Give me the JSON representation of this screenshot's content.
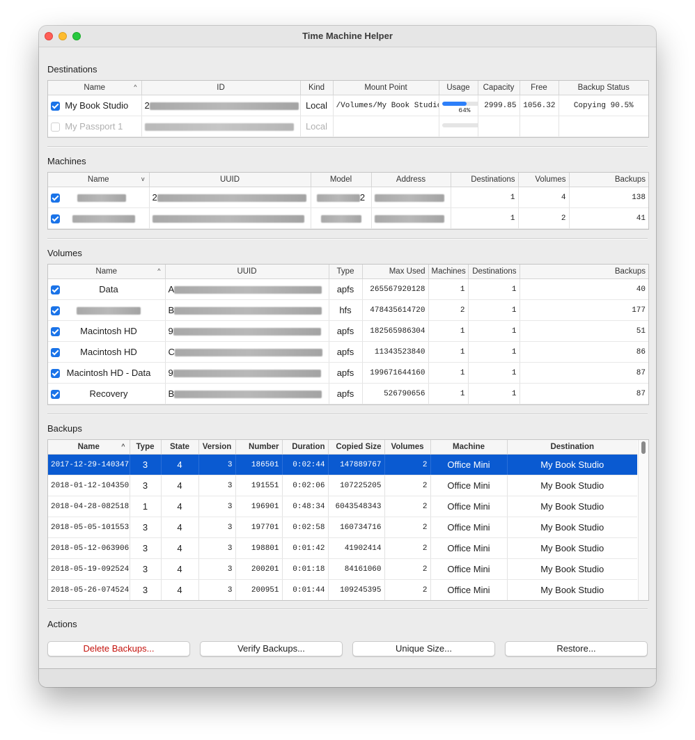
{
  "window": {
    "title": "Time Machine Helper"
  },
  "destinations": {
    "section_title": "Destinations",
    "columns": [
      "Name",
      "ID",
      "Kind",
      "Mount Point",
      "Usage",
      "Capacity",
      "Free",
      "Backup Status"
    ],
    "rows": [
      {
        "checked": true,
        "name": "My Book Studio",
        "id_prefix": "2",
        "kind": "Local",
        "mount_point": "/Volumes/My Book Studio",
        "usage_fraction": 0.64,
        "usage_label": "64%",
        "capacity": "2999.85",
        "free": "1056.32",
        "status": "Copying 90.5%"
      },
      {
        "checked": false,
        "name": "My Passport 1",
        "id_prefix": "",
        "kind": "Local",
        "mount_point": "",
        "usage_fraction": 0,
        "usage_label": "",
        "capacity": "",
        "free": "",
        "status": ""
      }
    ]
  },
  "machines": {
    "section_title": "Machines",
    "columns": [
      "Name",
      "UUID",
      "Model",
      "Address",
      "Destinations",
      "Volumes",
      "Backups"
    ],
    "rows": [
      {
        "checked": true,
        "uuid_prefix": "2",
        "model_suffix": "2",
        "destinations": "1",
        "volumes": "4",
        "backups": "138"
      },
      {
        "checked": true,
        "uuid_prefix": "",
        "model_suffix": "",
        "destinations": "1",
        "volumes": "2",
        "backups": "41"
      }
    ]
  },
  "volumes": {
    "section_title": "Volumes",
    "columns": [
      "Name",
      "UUID",
      "Type",
      "Max Used",
      "Machines",
      "Destinations",
      "Backups"
    ],
    "rows": [
      {
        "checked": true,
        "name": "Data",
        "uuid_prefix": "A",
        "type": "apfs",
        "max_used": "265567920128",
        "machines": "1",
        "destinations": "1",
        "backups": "40"
      },
      {
        "checked": true,
        "name": "",
        "uuid_prefix": "B",
        "type": "hfs",
        "max_used": "478435614720",
        "machines": "2",
        "destinations": "1",
        "backups": "177"
      },
      {
        "checked": true,
        "name": "Macintosh HD",
        "uuid_prefix": "9",
        "type": "apfs",
        "max_used": "182565986304",
        "machines": "1",
        "destinations": "1",
        "backups": "51"
      },
      {
        "checked": true,
        "name": "Macintosh HD",
        "uuid_prefix": "C",
        "type": "apfs",
        "max_used": "11343523840",
        "machines": "1",
        "destinations": "1",
        "backups": "86"
      },
      {
        "checked": true,
        "name": "Macintosh HD - Data",
        "uuid_prefix": "9",
        "type": "apfs",
        "max_used": "199671644160",
        "machines": "1",
        "destinations": "1",
        "backups": "87"
      },
      {
        "checked": true,
        "name": "Recovery",
        "uuid_prefix": "B",
        "type": "apfs",
        "max_used": "526790656",
        "machines": "1",
        "destinations": "1",
        "backups": "87"
      }
    ]
  },
  "backups": {
    "section_title": "Backups",
    "columns": [
      "Name",
      "Type",
      "State",
      "Version",
      "Number",
      "Duration",
      "Copied Size",
      "Volumes",
      "Machine",
      "Destination"
    ],
    "rows": [
      {
        "name": "2017-12-29-140347",
        "type": "3",
        "state": "4",
        "version": "3",
        "number": "186501",
        "duration": "0:02:44",
        "copied_size": "147889767",
        "volumes": "2",
        "machine": "Office Mini",
        "destination": "My Book Studio",
        "selected": true
      },
      {
        "name": "2018-01-12-104350",
        "type": "3",
        "state": "4",
        "version": "3",
        "number": "191551",
        "duration": "0:02:06",
        "copied_size": "107225205",
        "volumes": "2",
        "machine": "Office Mini",
        "destination": "My Book Studio"
      },
      {
        "name": "2018-04-28-082518",
        "type": "1",
        "state": "4",
        "version": "3",
        "number": "196901",
        "duration": "0:48:34",
        "copied_size": "6043548343",
        "volumes": "2",
        "machine": "Office Mini",
        "destination": "My Book Studio"
      },
      {
        "name": "2018-05-05-101553",
        "type": "3",
        "state": "4",
        "version": "3",
        "number": "197701",
        "duration": "0:02:58",
        "copied_size": "160734716",
        "volumes": "2",
        "machine": "Office Mini",
        "destination": "My Book Studio"
      },
      {
        "name": "2018-05-12-063906",
        "type": "3",
        "state": "4",
        "version": "3",
        "number": "198801",
        "duration": "0:01:42",
        "copied_size": "41902414",
        "volumes": "2",
        "machine": "Office Mini",
        "destination": "My Book Studio"
      },
      {
        "name": "2018-05-19-092524",
        "type": "3",
        "state": "4",
        "version": "3",
        "number": "200201",
        "duration": "0:01:18",
        "copied_size": "84161060",
        "volumes": "2",
        "machine": "Office Mini",
        "destination": "My Book Studio"
      },
      {
        "name": "2018-05-26-074524",
        "type": "3",
        "state": "4",
        "version": "3",
        "number": "200951",
        "duration": "0:01:44",
        "copied_size": "109245395",
        "volumes": "2",
        "machine": "Office Mini",
        "destination": "My Book Studio"
      }
    ]
  },
  "actions": {
    "section_title": "Actions",
    "delete_label": "Delete Backups...",
    "verify_label": "Verify Backups...",
    "unique_label": "Unique Size...",
    "restore_label": "Restore..."
  },
  "colors": {
    "selection": "#0a5ad1",
    "checkbox": "#1a73e8",
    "danger_text": "#c4120c",
    "usage_fill": "#2d7ff9"
  },
  "icons": {
    "sort_ascending": "chevron-up-icon",
    "sort_descending": "chevron-down-icon"
  }
}
